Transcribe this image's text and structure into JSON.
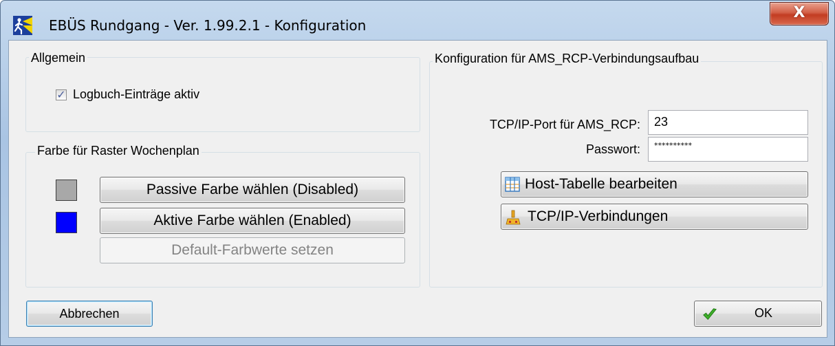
{
  "window": {
    "title": "EBÜS Rundgang - Ver. 1.99.2.1 - Konfiguration",
    "close_label": "X"
  },
  "general": {
    "group_title": "Allgemein",
    "logbook_label": "Logbuch-Einträge aktiv",
    "logbook_checked": true
  },
  "colors": {
    "group_title": "Farbe für Raster Wochenplan",
    "passive_button": "Passive Farbe wählen (Disabled)",
    "active_button": "Aktive Farbe wählen (Enabled)",
    "default_button": "Default-Farbwerte setzen",
    "passive_color": "#a8a8a8",
    "active_color": "#0000ff"
  },
  "ams": {
    "group_title": "Konfiguration für AMS_RCP-Verbindungsaufbau",
    "port_label": "TCP/IP-Port für AMS_RCP:",
    "port_value": "23",
    "password_label": "Passwort:",
    "password_value": "**********",
    "host_table_button": "Host-Tabelle bearbeiten",
    "tcp_button": "TCP/IP-Verbindungen"
  },
  "footer": {
    "cancel_label": "Abbrechen",
    "ok_label": "OK"
  },
  "icons": {
    "app": "runner-icon",
    "close": "close-icon",
    "host_table": "table-icon",
    "tcp": "network-icon",
    "ok": "checkmark-icon"
  }
}
